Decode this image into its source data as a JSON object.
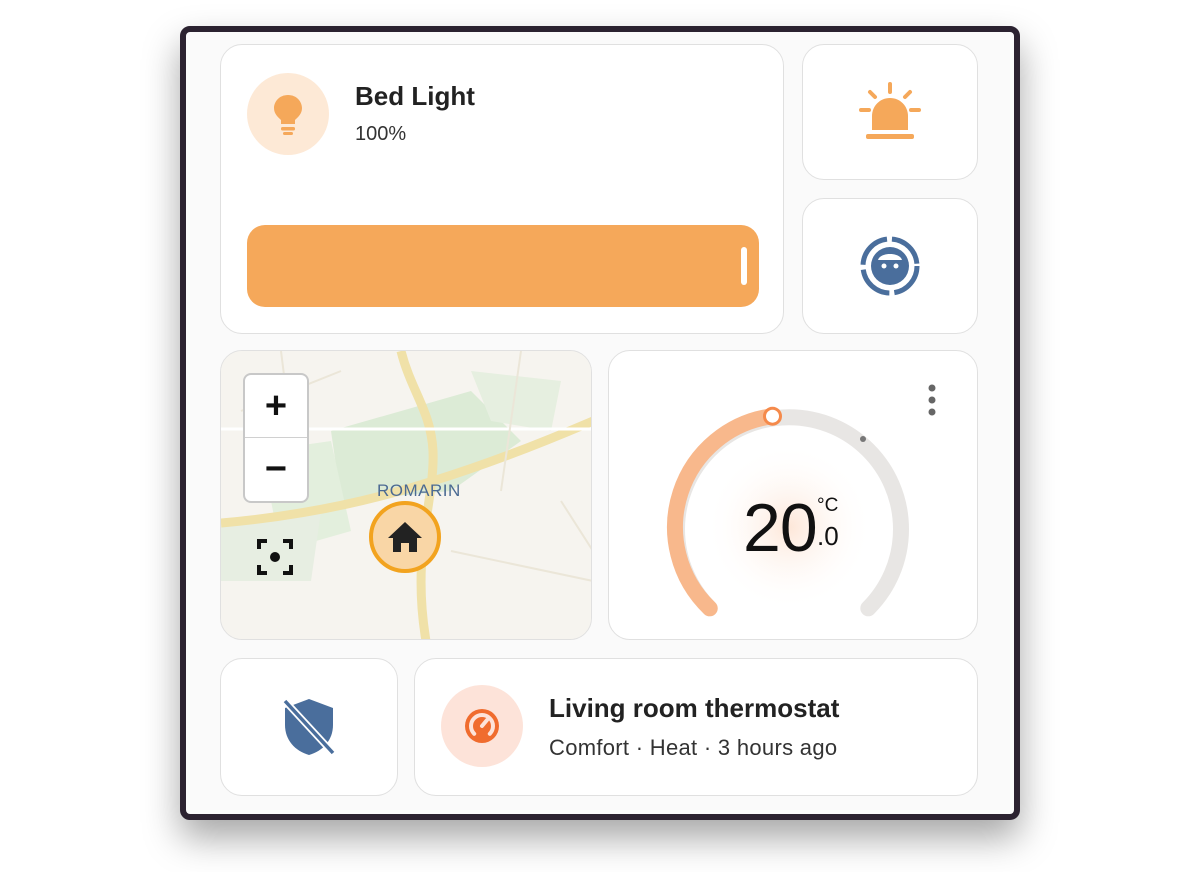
{
  "light": {
    "name": "Bed Light",
    "state": "100%",
    "brightness_percent": 100,
    "accent": "#f5a85a",
    "icon": "lightbulb-icon"
  },
  "siren": {
    "icon": "alarm-light-icon",
    "color": "#f5a85a"
  },
  "vacuum": {
    "icon": "robot-vacuum-icon",
    "color": "#4a6e9c"
  },
  "map": {
    "place_label": "ROMARIN",
    "zoom_in": "+",
    "zoom_out": "−",
    "marker_icon": "home-icon",
    "recenter_icon": "recenter-icon"
  },
  "thermostat": {
    "temp_whole": "20",
    "temp_decimal": ".0",
    "unit": "°C",
    "target_temperature": 20.0,
    "arc_color": "#f8b88c",
    "menu_icon": "more-vert-icon"
  },
  "shield": {
    "icon": "shield-off-icon",
    "color": "#4a6e9c"
  },
  "living_room": {
    "name": "Living room thermostat",
    "state": "Comfort · Heat · 3 hours ago",
    "icon": "thermostat-icon",
    "color": "#f06c2e"
  }
}
